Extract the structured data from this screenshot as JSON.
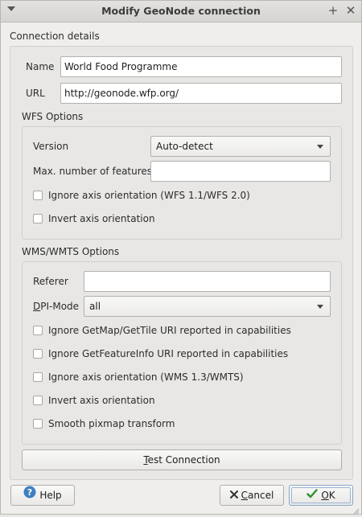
{
  "window": {
    "title": "Modify GeoNode connection"
  },
  "connection": {
    "section_title": "Connection details",
    "name_label": "Name",
    "name_value": "World Food Programme",
    "url_label": "URL",
    "url_value": "http://geonode.wfp.org/"
  },
  "wfs": {
    "section_title": "WFS Options",
    "version_label": "Version",
    "version_value": "Auto-detect",
    "max_features_label": "Max. number of features",
    "max_features_value": "",
    "ignore_axis_label": "Ignore axis orientation (WFS 1.1/WFS 2.0)",
    "ignore_axis_checked": false,
    "invert_axis_label": "Invert axis orientation",
    "invert_axis_checked": false
  },
  "wms": {
    "section_title": "WMS/WMTS Options",
    "referer_label": "Referer",
    "referer_value": "",
    "dpi_label_first": "D",
    "dpi_label_rest": "PI-Mode",
    "dpi_value": "all",
    "checkboxes": [
      {
        "label": "Ignore GetMap/GetTile URI reported in capabilities",
        "checked": false
      },
      {
        "label": "Ignore GetFeatureInfo URI reported in capabilities",
        "checked": false
      },
      {
        "label": "Ignore axis orientation (WMS 1.3/WMTS)",
        "checked": false
      },
      {
        "label": "Invert axis orientation",
        "checked": false
      },
      {
        "label": "Smooth pixmap transform",
        "checked": false
      }
    ]
  },
  "buttons": {
    "test_connection_first": "T",
    "test_connection_rest": "est Connection",
    "help_label": "Help",
    "cancel_first": "C",
    "cancel_rest": "ancel",
    "ok_first": "O",
    "ok_rest": "K"
  },
  "icons": {
    "help": "help-circle-icon",
    "cancel": "x-icon",
    "ok": "check-icon"
  },
  "colors": {
    "help_icon": "#3d7fc1",
    "ok_icon": "#2e8f2e",
    "cancel_icon": "#333333"
  }
}
